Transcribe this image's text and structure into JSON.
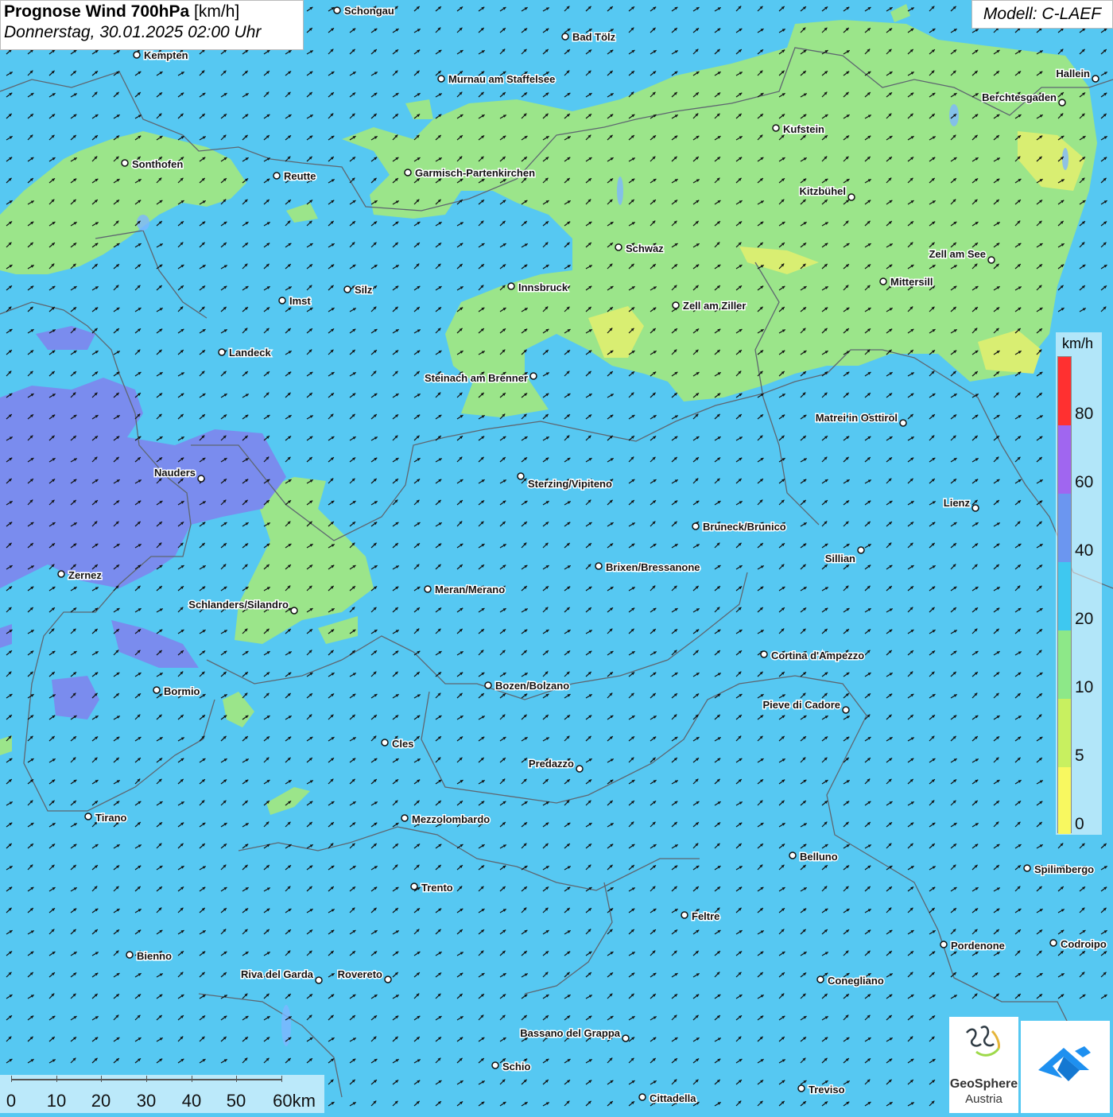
{
  "header": {
    "title_bold": "Prognose Wind 700hPa",
    "title_unit": "[km/h]",
    "datetime": "Donnerstag, 30.01.2025 02:00 Uhr",
    "model": "Modell: C-LAEF"
  },
  "legend": {
    "unit": "km/h",
    "ticks": [
      "80",
      "60",
      "40",
      "20",
      "10",
      "5",
      "0"
    ],
    "colors": [
      "#ff3030",
      "#a066f0",
      "#6b96f0",
      "#3ec8f0",
      "#8de888",
      "#c8f060",
      "#f8f860"
    ]
  },
  "scale": {
    "labels": [
      "0",
      "10",
      "20",
      "30",
      "40",
      "50",
      "60km"
    ]
  },
  "logos": {
    "geosphere_line1": "GeoSphere",
    "geosphere_line2": "Austria"
  },
  "colors": {
    "background_wind_10_20": "#56c8f2",
    "wind_5_10": "#9be58a",
    "wind_0_5": "#e6f070",
    "wind_20_40": "#7a8cee",
    "arrows": "#000000"
  },
  "cities": [
    {
      "name": "Schongau"
    },
    {
      "name": "Bad Tölz"
    },
    {
      "name": "Kempten"
    },
    {
      "name": "Murnau am Staffelsee"
    },
    {
      "name": "Hallein"
    },
    {
      "name": "Berchtesgaden"
    },
    {
      "name": "Kufstein"
    },
    {
      "name": "Sonthofen"
    },
    {
      "name": "Reutte"
    },
    {
      "name": "Garmisch-Partenkirchen"
    },
    {
      "name": "Kitzbühel"
    },
    {
      "name": "Schwaz"
    },
    {
      "name": "Zell am See"
    },
    {
      "name": "Mittersill"
    },
    {
      "name": "Innsbruck"
    },
    {
      "name": "Silz"
    },
    {
      "name": "Imst"
    },
    {
      "name": "Zell am Ziller"
    },
    {
      "name": "Landeck"
    },
    {
      "name": "Steinach am Brenner"
    },
    {
      "name": "Matrei in Osttirol"
    },
    {
      "name": "Nauders"
    },
    {
      "name": "Sterzing/Vipiteno"
    },
    {
      "name": "Lienz"
    },
    {
      "name": "Bruneck/Brunico"
    },
    {
      "name": "Sillian"
    },
    {
      "name": "Brixen/Bressanone"
    },
    {
      "name": "Zernez"
    },
    {
      "name": "Meran/Merano"
    },
    {
      "name": "Schlanders/Silandro"
    },
    {
      "name": "Cortina d'Ampezzo"
    },
    {
      "name": "Bozen/Bolzano"
    },
    {
      "name": "Bormio"
    },
    {
      "name": "Pieve di Cadore"
    },
    {
      "name": "Cles"
    },
    {
      "name": "Predazzo"
    },
    {
      "name": "Tirano"
    },
    {
      "name": "Mezzolombardo"
    },
    {
      "name": "Belluno"
    },
    {
      "name": "Spilimbergo"
    },
    {
      "name": "Trento"
    },
    {
      "name": "Feltre"
    },
    {
      "name": "Pordenone"
    },
    {
      "name": "Codroipo"
    },
    {
      "name": "Bienno"
    },
    {
      "name": "Riva del Garda"
    },
    {
      "name": "Rovereto"
    },
    {
      "name": "Conegliano"
    },
    {
      "name": "Bassano del Grappa"
    },
    {
      "name": "Schio"
    },
    {
      "name": "Treviso"
    },
    {
      "name": "Cittadella"
    }
  ]
}
